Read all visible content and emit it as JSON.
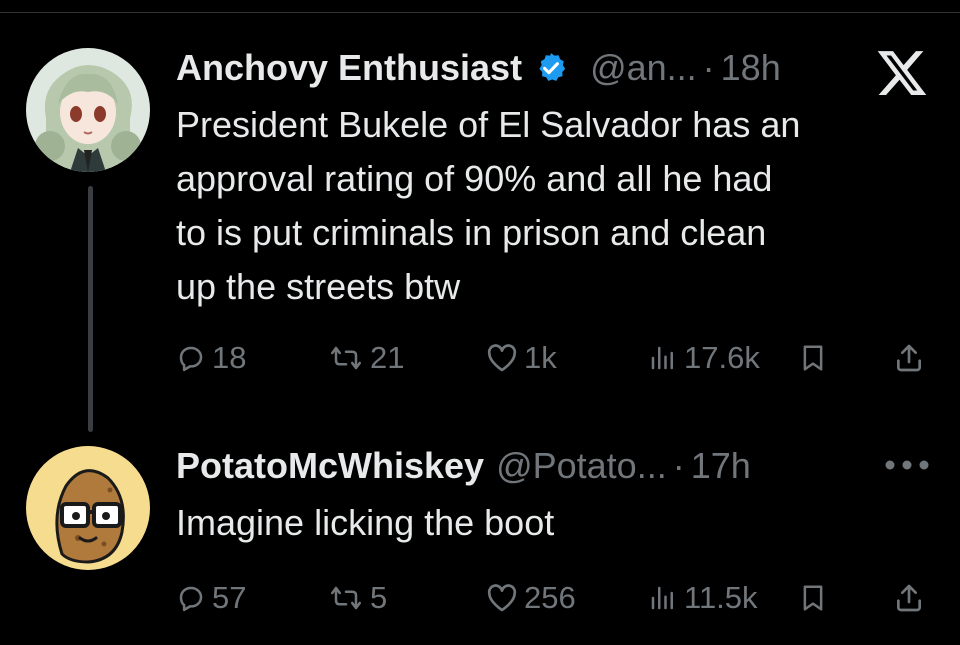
{
  "theme": {
    "background": "#000000",
    "text": "#e7e9ea",
    "muted": "#71767b",
    "verified": "#1d9bf0",
    "thread_line": "#3a3e43"
  },
  "tweets": [
    {
      "author": "Anchovy Enthusiast",
      "verified": true,
      "handle": "@an...",
      "separator": "·",
      "time": "18h",
      "avatar": "anime-girl-avatar",
      "text": "President Bukele of El Salvador has an approval rating of 90% and all he had to is put criminals in prison and clean up the streets btw",
      "lines": [
        "President Bukele of El Salvador has an",
        "approval rating of 90% and all he had",
        "to is put criminals in prison and clean",
        "up the streets btw"
      ],
      "replies": "18",
      "reposts": "21",
      "likes": "1k",
      "views": "17.6k",
      "corner_icon": "x-logo-icon"
    },
    {
      "author": "PotatoMcWhiskey",
      "verified": false,
      "handle": "@Potato...",
      "separator": "·",
      "time": "17h",
      "avatar": "potato-glasses-avatar",
      "text": "Imagine licking the boot",
      "replies": "57",
      "reposts": "5",
      "likes": "256",
      "views": "11.5k",
      "corner_icon": "more-icon"
    }
  ]
}
